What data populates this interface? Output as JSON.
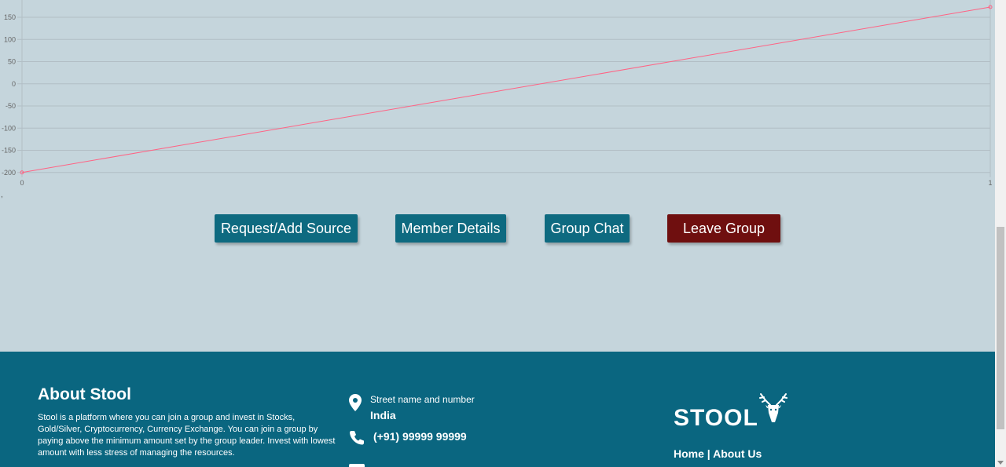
{
  "chart_data": {
    "type": "line",
    "x": [
      0,
      1
    ],
    "series": [
      {
        "values": [
          -200,
          173
        ]
      }
    ],
    "y_ticks": [
      "150",
      "100",
      "50",
      "0",
      "-50",
      "-100",
      "-150",
      "-200"
    ],
    "x_ticks": [
      "0",
      "1"
    ],
    "grid": true,
    "line_color": "#ff6384"
  },
  "stray_text": ",",
  "buttons": {
    "request_add_source": "Request/Add Source",
    "member_details": "Member Details",
    "group_chat": "Group Chat",
    "leave_group": "Leave Group"
  },
  "footer": {
    "about_title": "About Stool",
    "about_text": "Stool is a platform where you can join a group and invest in Stocks, Gold/Silver, Cryptocurrency, Currency Exchange. You can join a group by paying above the minimum amount set by the group leader. Invest with lowest amount with less stress of managing the resources.",
    "address_street": "Street name and number",
    "address_country": "India",
    "phone": "(+91) 99999 99999",
    "brand": "STOOL",
    "links": [
      "Home",
      "|",
      "About Us"
    ]
  },
  "colors": {
    "page_bg": "#c5d5dc",
    "footer_bg": "#0a6680",
    "button_teal": "#0e6a80",
    "button_red": "#6f0f0f"
  }
}
